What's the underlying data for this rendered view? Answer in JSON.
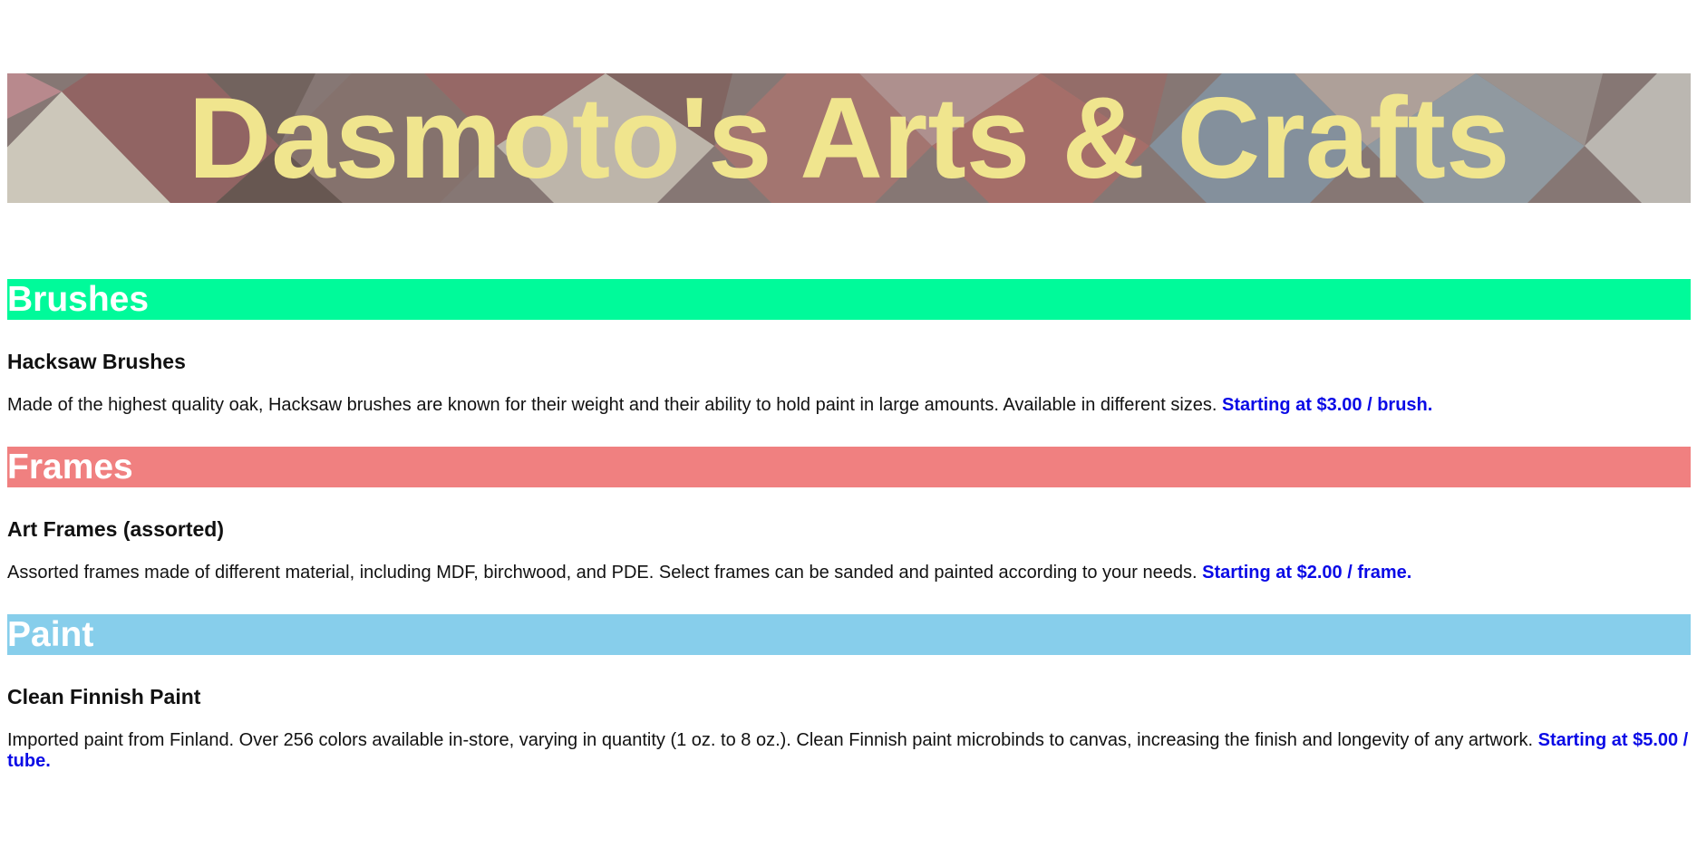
{
  "header": {
    "title": "Dasmoto's Arts & Crafts"
  },
  "colors": {
    "title_text": "#f0e58e",
    "brushes_bg": "#00fa9a",
    "frames_bg": "#f08080",
    "paint_bg": "#87ceeb",
    "price_text": "#0a0ae6"
  },
  "sections": {
    "brushes": {
      "heading": "Brushes",
      "item_title": "Hacksaw Brushes",
      "description": "Made of the highest quality oak, Hacksaw brushes are known for their weight and their ability to hold paint in large amounts. Available in different sizes.",
      "price": "Starting at $3.00 / brush."
    },
    "frames": {
      "heading": "Frames",
      "item_title": "Art Frames (assorted)",
      "description": "Assorted frames made of different material, including MDF, birchwood, and PDE. Select frames can be sanded and painted according to your needs.",
      "price": "Starting at $2.00 / frame."
    },
    "paint": {
      "heading": "Paint",
      "item_title": "Clean Finnish Paint",
      "description": "Imported paint from Finland. Over 256 colors available in-store, varying in quantity (1 oz. to 8 oz.). Clean Finnish paint microbinds to canvas, increasing the finish and longevity of any artwork.",
      "price": "Starting at $5.00 / tube."
    }
  }
}
